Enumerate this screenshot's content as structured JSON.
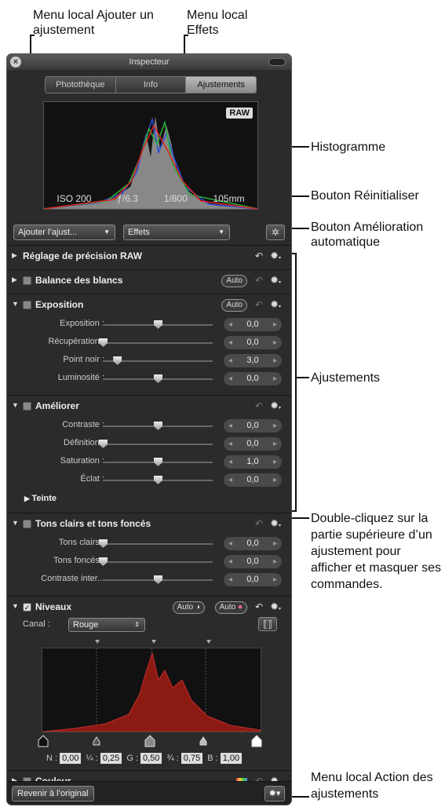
{
  "callouts": {
    "local_add": "Menu local Ajouter un ajustement",
    "local_effects": "Menu local Effets",
    "histogram": "Histogramme",
    "reset": "Bouton Réinitialiser",
    "auto_enhance": "Bouton Amélioration automatique",
    "adjustments": "Ajustements",
    "double_click": "Double-cliquez sur la partie supérieure d’un ajustement pour afficher et masquer ses commandes.",
    "action_menu": "Menu local Action des ajustements"
  },
  "window": {
    "title": "Inspecteur"
  },
  "tabs": [
    "Photothèque",
    "Info",
    "Ajustements"
  ],
  "histogram": {
    "badge": "RAW",
    "iso": "ISO 200",
    "aperture": "ƒ/6.3",
    "shutter": "1/800",
    "focal": "105mm"
  },
  "toolbar": {
    "add_label": "Ajouter l’ajust...",
    "effects_label": "Effets"
  },
  "sections": {
    "raw": "Réglage de précision RAW",
    "wb": "Balance des blancs",
    "exposure": "Exposition",
    "enhance": "Améliorer",
    "tint": "Teinte",
    "shadows": "Tons clairs et tons foncés",
    "levels": "Niveaux",
    "color": "Couleur",
    "auto": "Auto"
  },
  "exposure_rows": [
    {
      "label": "Exposition :",
      "value": "0,0",
      "level": 0.5
    },
    {
      "label": "Récupération :",
      "value": "0,0",
      "level": 0.0
    },
    {
      "label": "Point noir :",
      "value": "3,0",
      "level": 0.13
    },
    {
      "label": "Luminosité :",
      "value": "0,0",
      "level": 0.5
    }
  ],
  "enhance_rows": [
    {
      "label": "Contraste :",
      "value": "0,0",
      "level": 0.5
    },
    {
      "label": "Définition :",
      "value": "0,0",
      "level": 0.0
    },
    {
      "label": "Saturation :",
      "value": "1,0",
      "level": 0.5
    },
    {
      "label": "Éclat :",
      "value": "0,0",
      "level": 0.5
    }
  ],
  "shadow_rows": [
    {
      "label": "Tons clairs :",
      "value": "0,0",
      "level": 0.0
    },
    {
      "label": "Tons foncés :",
      "value": "0,0",
      "level": 0.0
    },
    {
      "label": "Contraste inter...",
      "value": "0,0",
      "level": 0.5
    }
  ],
  "levels": {
    "canal_label": "Canal :",
    "channel": "Rouge",
    "n_label": "N :",
    "n": "0,00",
    "q1_label": "¼ :",
    "q1": "0,25",
    "g_label": "G :",
    "g": "0,50",
    "q3_label": "¾ :",
    "q3": "0,75",
    "b_label": "B :",
    "b": "1,00"
  },
  "bottom": {
    "revert": "Revenir à l’original"
  }
}
